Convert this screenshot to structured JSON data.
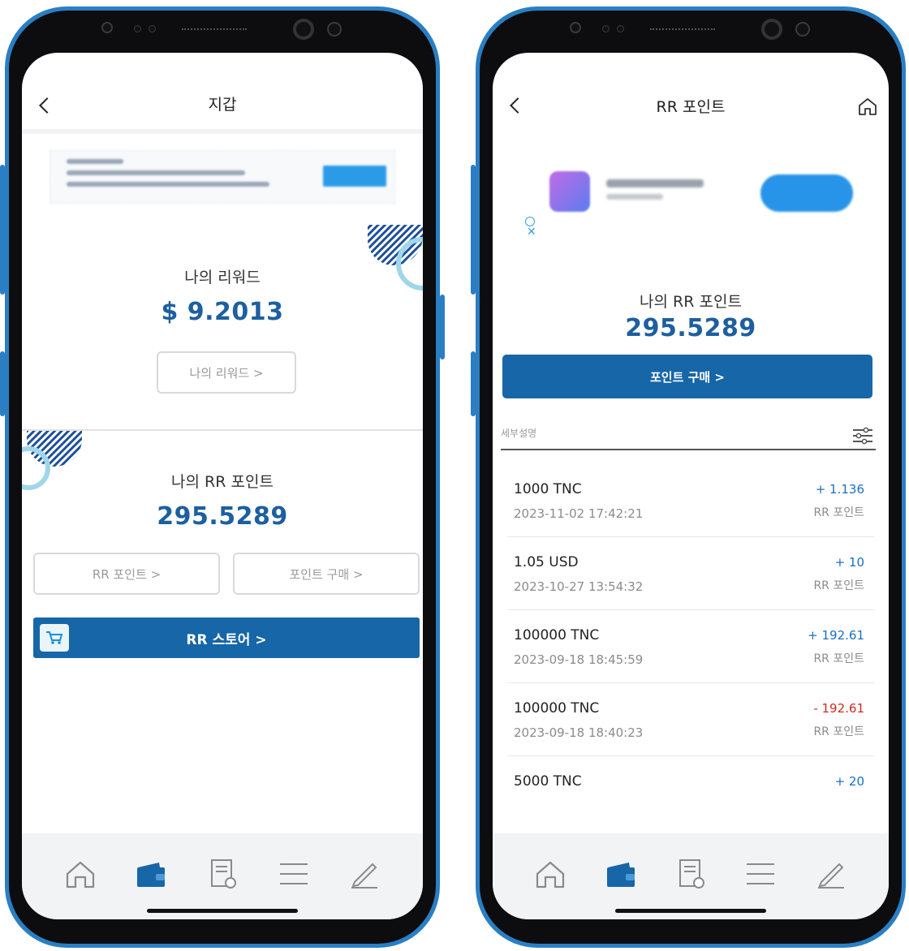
{
  "left": {
    "header": {
      "title": "지갑"
    },
    "rewards": {
      "label": "나의 리워드",
      "amount": "$ 9.2013",
      "button": "나의 리워드 >"
    },
    "rr_points": {
      "label": "나의 RR 포인트",
      "amount": "295.5289",
      "button_points": "RR 포인트 >",
      "button_buy": "포인트 구매 >"
    },
    "store": {
      "label": "RR 스토어 >"
    }
  },
  "right": {
    "header": {
      "title": "RR 포인트"
    },
    "rr_points": {
      "label": "나의 RR 포인트",
      "amount": "295.5289",
      "buy_button": "포인트 구매 >"
    },
    "details_label": "세부설명",
    "transactions": [
      {
        "name": "1000 TNC",
        "date": "2023-11-02 17:42:21",
        "amount": "+ 1.136",
        "unit": "RR 포인트",
        "positive": true
      },
      {
        "name": "1.05 USD",
        "date": "2023-10-27 13:54:32",
        "amount": "+ 10",
        "unit": "RR 포인트",
        "positive": true
      },
      {
        "name": "100000 TNC",
        "date": "2023-09-18 18:45:59",
        "amount": "+ 192.61",
        "unit": "RR 포인트",
        "positive": true
      },
      {
        "name": "100000 TNC",
        "date": "2023-09-18 18:40:23",
        "amount": "- 192.61",
        "unit": "RR 포인트",
        "positive": false
      },
      {
        "name": "5000 TNC",
        "date": "",
        "amount": "+ 20",
        "unit": "",
        "positive": true
      }
    ]
  },
  "tabbar": {
    "items": [
      {
        "icon": "home-icon"
      },
      {
        "icon": "wallet-icon",
        "active": true
      },
      {
        "icon": "receipt-icon"
      },
      {
        "icon": "menu-icon"
      },
      {
        "icon": "edit-icon"
      }
    ]
  },
  "colors": {
    "brand": "#1766a8",
    "amount": "#1d5f9f",
    "positive": "#1a6fc4",
    "negative": "#d0281f",
    "frame": "#2a7fc4"
  }
}
